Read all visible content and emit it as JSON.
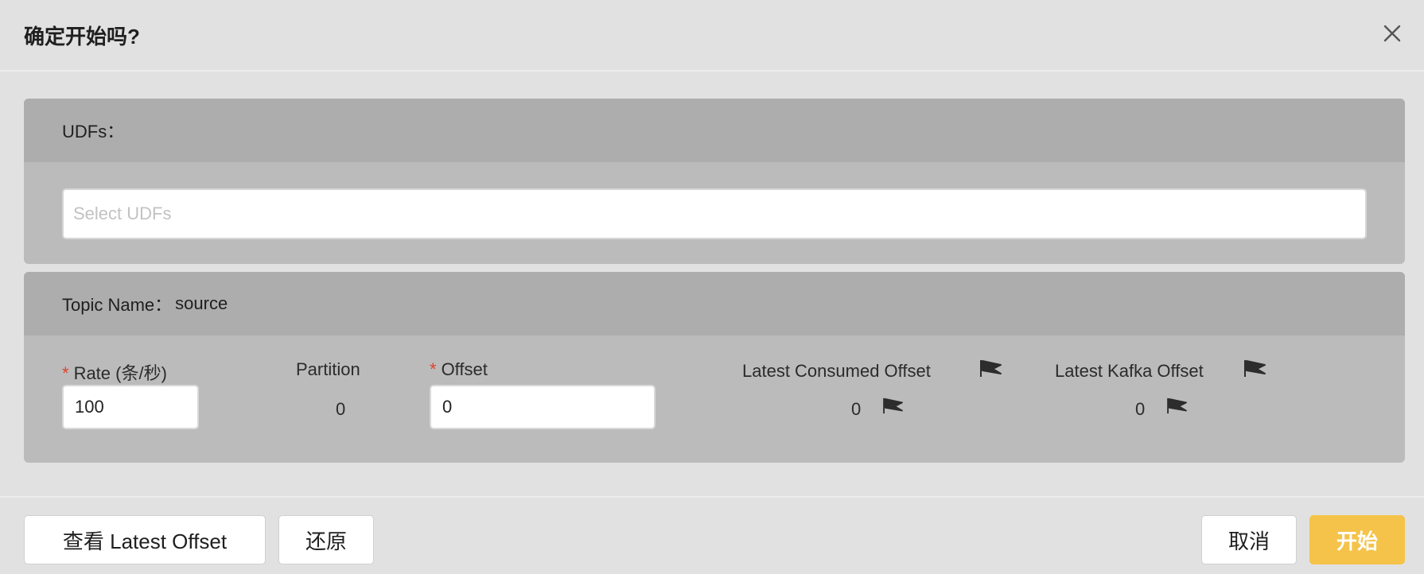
{
  "dialog": {
    "title": "确定开始吗?"
  },
  "udfs": {
    "label": "UDFs：",
    "placeholder": "Select UDFs"
  },
  "topic": {
    "label": "Topic Name：",
    "name": "source",
    "rate_label": "Rate (条/秒)",
    "rate_required": "*",
    "rate_value": "100",
    "partition_label": "Partition",
    "partition_value": "0",
    "offset_label": "Offset",
    "offset_required": "*",
    "offset_value": "0",
    "latest_consumed_label": "Latest Consumed Offset",
    "latest_consumed_value": "0",
    "latest_kafka_label": "Latest Kafka Offset",
    "latest_kafka_value": "0"
  },
  "footer": {
    "view_latest_label": "查看 Latest Offset",
    "restore_label": "还原",
    "cancel_label": "取消",
    "start_label": "开始"
  },
  "colors": {
    "primary": "#f5c349",
    "required": "#e0432f"
  },
  "icons": [
    "close-icon",
    "flag-icon"
  ]
}
